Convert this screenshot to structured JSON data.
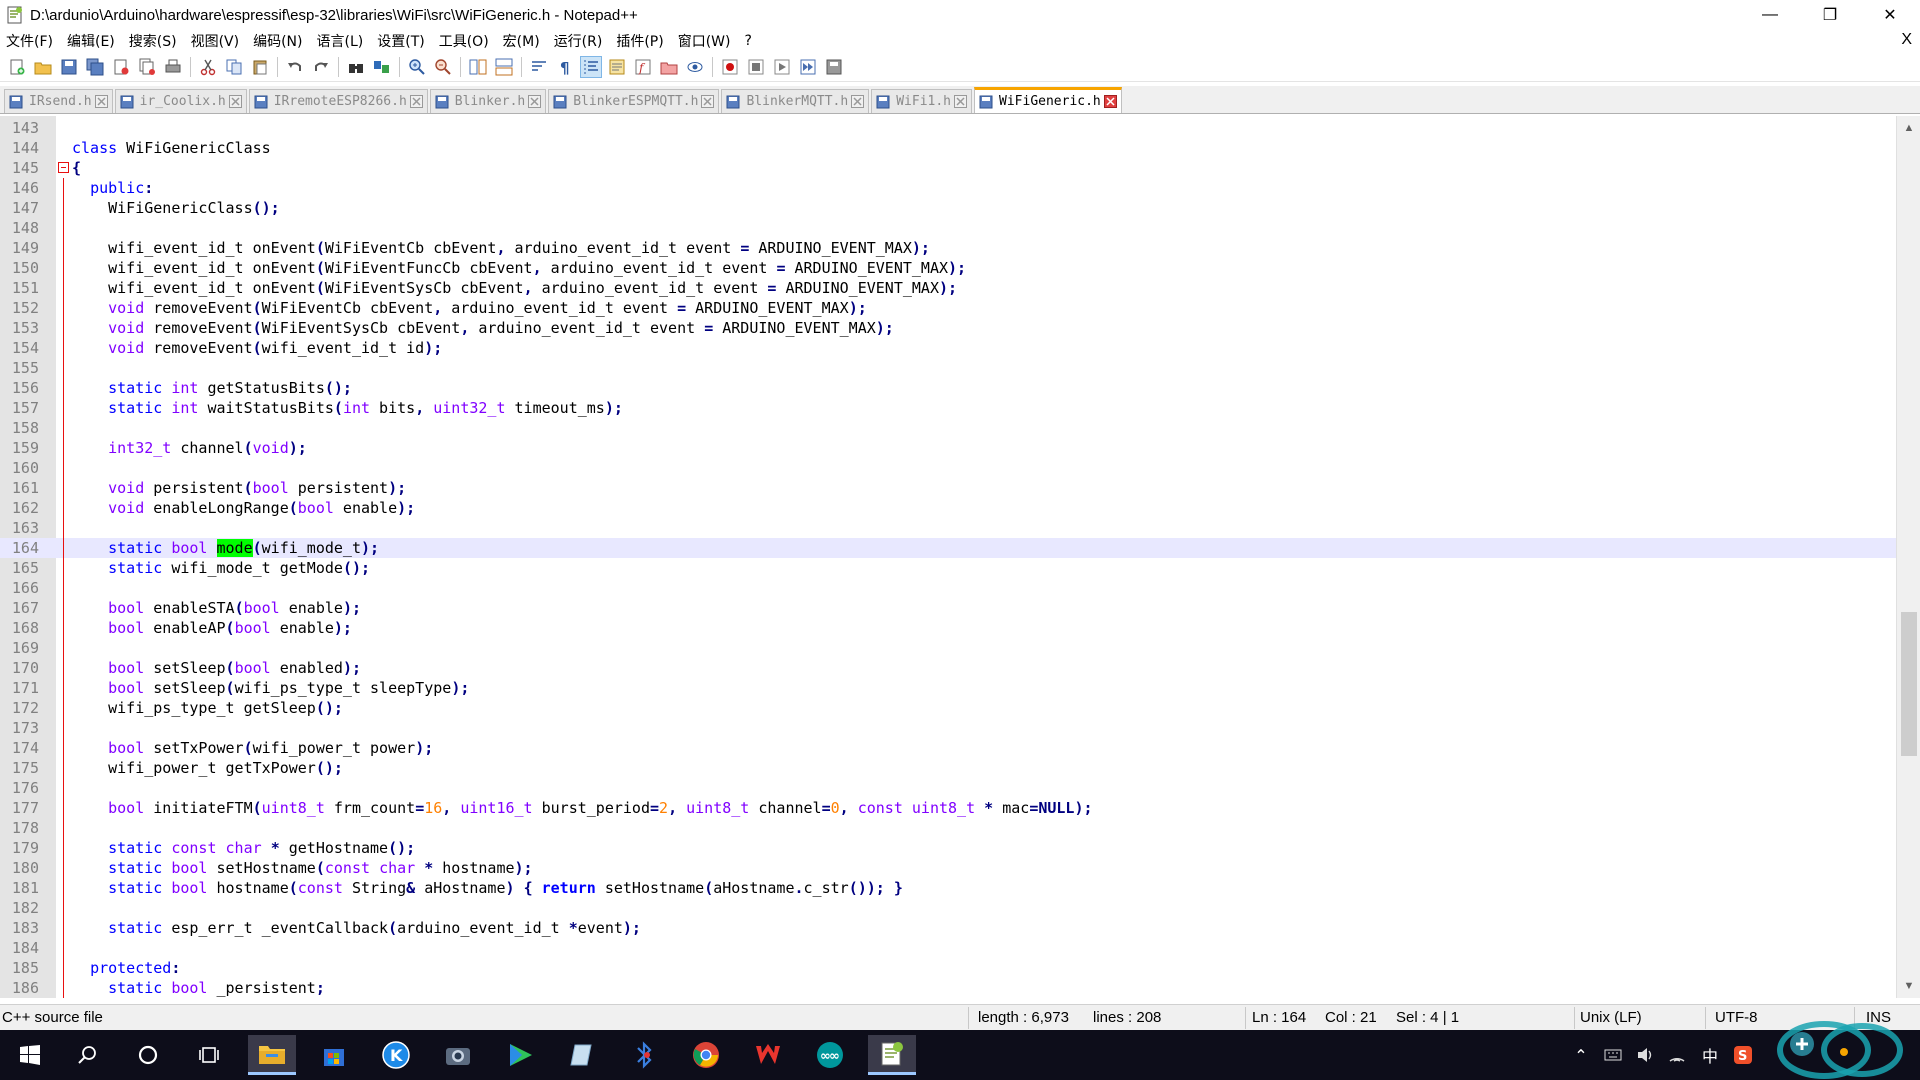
{
  "window": {
    "title": "D:\\ardunio\\Arduino\\hardware\\espressif\\esp-32\\libraries\\WiFi\\src\\WiFiGeneric.h - Notepad++",
    "minimize": "—",
    "maximize": "❐",
    "close": "✕"
  },
  "menu": {
    "items": [
      "文件(F)",
      "编辑(E)",
      "搜索(S)",
      "视图(V)",
      "编码(N)",
      "语言(L)",
      "设置(T)",
      "工具(O)",
      "宏(M)",
      "运行(R)",
      "插件(P)",
      "窗口(W)",
      "?"
    ],
    "close": "X"
  },
  "toolbar": {
    "icons": [
      "new-file-icon",
      "open-file-icon",
      "save-icon",
      "save-all-icon",
      "close-icon",
      "close-all-icon",
      "print-icon",
      "cut-icon",
      "copy-icon",
      "paste-icon",
      "undo-icon",
      "redo-icon",
      "find-icon",
      "replace-icon",
      "zoom-in-icon",
      "zoom-out-icon",
      "sync-vertical-icon",
      "sync-horizontal-icon",
      "word-wrap-icon",
      "show-all-chars-icon",
      "indent-guide-icon",
      "document-map-icon",
      "function-list-icon",
      "folder-as-workspace-icon",
      "monitoring-icon",
      "record-macro-icon",
      "stop-macro-icon",
      "play-macro-icon",
      "run-macro-multiple-icon",
      "save-macro-icon"
    ]
  },
  "tabs": [
    {
      "label": "IRsend.h",
      "active": false
    },
    {
      "label": "ir_Coolix.h",
      "active": false
    },
    {
      "label": "IRremoteESP8266.h",
      "active": false
    },
    {
      "label": "Blinker.h",
      "active": false
    },
    {
      "label": "BlinkerESPMQTT.h",
      "active": false
    },
    {
      "label": "BlinkerMQTT.h",
      "active": false
    },
    {
      "label": "WiFi1.h",
      "active": false
    },
    {
      "label": "WiFiGeneric.h",
      "active": true
    }
  ],
  "editor": {
    "current_line": 164,
    "lines": [
      {
        "n": "143",
        "html": ""
      },
      {
        "n": "144",
        "html": "<span class=\"kw\">class</span> WiFiGenericClass"
      },
      {
        "n": "145",
        "html": "<span class=\"op\">{</span>"
      },
      {
        "n": "146",
        "html": "  <span class=\"kw\">public</span><span class=\"op\">:</span>"
      },
      {
        "n": "147",
        "html": "    WiFiGenericClass<span class=\"op\">();</span>"
      },
      {
        "n": "148",
        "html": ""
      },
      {
        "n": "149",
        "html": "    wifi_event_id_t onEvent<span class=\"op\">(</span>WiFiEventCb cbEvent<span class=\"op\">,</span> arduino_event_id_t event <span class=\"op\">=</span> ARDUINO_EVENT_MAX<span class=\"op\">);</span>"
      },
      {
        "n": "150",
        "html": "    wifi_event_id_t onEvent<span class=\"op\">(</span>WiFiEventFuncCb cbEvent<span class=\"op\">,</span> arduino_event_id_t event <span class=\"op\">=</span> ARDUINO_EVENT_MAX<span class=\"op\">);</span>"
      },
      {
        "n": "151",
        "html": "    wifi_event_id_t onEvent<span class=\"op\">(</span>WiFiEventSysCb cbEvent<span class=\"op\">,</span> arduino_event_id_t event <span class=\"op\">=</span> ARDUINO_EVENT_MAX<span class=\"op\">);</span>"
      },
      {
        "n": "152",
        "html": "    <span class=\"ty\">void</span> removeEvent<span class=\"op\">(</span>WiFiEventCb cbEvent<span class=\"op\">,</span> arduino_event_id_t event <span class=\"op\">=</span> ARDUINO_EVENT_MAX<span class=\"op\">);</span>"
      },
      {
        "n": "153",
        "html": "    <span class=\"ty\">void</span> removeEvent<span class=\"op\">(</span>WiFiEventSysCb cbEvent<span class=\"op\">,</span> arduino_event_id_t event <span class=\"op\">=</span> ARDUINO_EVENT_MAX<span class=\"op\">);</span>"
      },
      {
        "n": "154",
        "html": "    <span class=\"ty\">void</span> removeEvent<span class=\"op\">(</span>wifi_event_id_t id<span class=\"op\">);</span>"
      },
      {
        "n": "155",
        "html": ""
      },
      {
        "n": "156",
        "html": "    <span class=\"kw\">static</span> <span class=\"ty\">int</span> getStatusBits<span class=\"op\">();</span>"
      },
      {
        "n": "157",
        "html": "    <span class=\"kw\">static</span> <span class=\"ty\">int</span> waitStatusBits<span class=\"op\">(</span><span class=\"ty\">int</span> bits<span class=\"op\">,</span> <span class=\"ty\">uint32_t</span> timeout_ms<span class=\"op\">);</span>"
      },
      {
        "n": "158",
        "html": ""
      },
      {
        "n": "159",
        "html": "    <span class=\"ty\">int32_t</span> channel<span class=\"op\">(</span><span class=\"ty\">void</span><span class=\"op\">);</span>"
      },
      {
        "n": "160",
        "html": ""
      },
      {
        "n": "161",
        "html": "    <span class=\"ty\">void</span> persistent<span class=\"op\">(</span><span class=\"ty\">bool</span> persistent<span class=\"op\">);</span>"
      },
      {
        "n": "162",
        "html": "    <span class=\"ty\">void</span> enableLongRange<span class=\"op\">(</span><span class=\"ty\">bool</span> enable<span class=\"op\">);</span>"
      },
      {
        "n": "163",
        "html": ""
      },
      {
        "n": "164",
        "html": "    <span class=\"kw\">static</span> <span class=\"ty\">bool</span> <span class=\"hl\">mode</span><span class=\"op\">(</span>wifi_mode_t<span class=\"op\">);</span>"
      },
      {
        "n": "165",
        "html": "    <span class=\"kw\">static</span> wifi_mode_t getMode<span class=\"op\">();</span>"
      },
      {
        "n": "166",
        "html": ""
      },
      {
        "n": "167",
        "html": "    <span class=\"ty\">bool</span> enableSTA<span class=\"op\">(</span><span class=\"ty\">bool</span> enable<span class=\"op\">);</span>"
      },
      {
        "n": "168",
        "html": "    <span class=\"ty\">bool</span> enableAP<span class=\"op\">(</span><span class=\"ty\">bool</span> enable<span class=\"op\">);</span>"
      },
      {
        "n": "169",
        "html": ""
      },
      {
        "n": "170",
        "html": "    <span class=\"ty\">bool</span> setSleep<span class=\"op\">(</span><span class=\"ty\">bool</span> enabled<span class=\"op\">);</span>"
      },
      {
        "n": "171",
        "html": "    <span class=\"ty\">bool</span> setSleep<span class=\"op\">(</span>wifi_ps_type_t sleepType<span class=\"op\">);</span>"
      },
      {
        "n": "172",
        "html": "    wifi_ps_type_t getSleep<span class=\"op\">();</span>"
      },
      {
        "n": "173",
        "html": ""
      },
      {
        "n": "174",
        "html": "    <span class=\"ty\">bool</span> setTxPower<span class=\"op\">(</span>wifi_power_t power<span class=\"op\">);</span>"
      },
      {
        "n": "175",
        "html": "    wifi_power_t getTxPower<span class=\"op\">();</span>"
      },
      {
        "n": "176",
        "html": ""
      },
      {
        "n": "177",
        "html": "    <span class=\"ty\">bool</span> initiateFTM<span class=\"op\">(</span><span class=\"ty\">uint8_t</span> frm_count<span class=\"op\">=</span><span class=\"num\">16</span><span class=\"op\">,</span> <span class=\"ty\">uint16_t</span> burst_period<span class=\"op\">=</span><span class=\"num\">2</span><span class=\"op\">,</span> <span class=\"ty\">uint8_t</span> channel<span class=\"op\">=</span><span class=\"num\">0</span><span class=\"op\">,</span> <span class=\"ty\">const</span> <span class=\"ty\">uint8_t</span> <span class=\"op\">*</span> mac<span class=\"op\">=</span><span class=\"op\">NULL);</span>"
      },
      {
        "n": "178",
        "html": ""
      },
      {
        "n": "179",
        "html": "    <span class=\"kw\">static</span> <span class=\"ty\">const</span> <span class=\"ty\">char</span> <span class=\"op\">*</span> getHostname<span class=\"op\">();</span>"
      },
      {
        "n": "180",
        "html": "    <span class=\"kw\">static</span> <span class=\"ty\">bool</span> setHostname<span class=\"op\">(</span><span class=\"ty\">const</span> <span class=\"ty\">char</span> <span class=\"op\">*</span> hostname<span class=\"op\">);</span>"
      },
      {
        "n": "181",
        "html": "    <span class=\"kw\">static</span> <span class=\"ty\">bool</span> hostname<span class=\"op\">(</span><span class=\"ty\">const</span> String<span class=\"op\">&amp;</span> aHostname<span class=\"op\">)</span> <span class=\"op\">{</span> <span class=\"op\" style=\"color:#0000ff\">return</span> setHostname<span class=\"op\">(</span>aHostname<span class=\"op\">.</span>c_str<span class=\"op\">());</span> <span class=\"op\">}</span>"
      },
      {
        "n": "182",
        "html": ""
      },
      {
        "n": "183",
        "html": "    <span class=\"kw\">static</span> esp_err_t _eventCallback<span class=\"op\">(</span>arduino_event_id_t <span class=\"op\">*</span>event<span class=\"op\">);</span>"
      },
      {
        "n": "184",
        "html": ""
      },
      {
        "n": "185",
        "html": "  <span class=\"kw\">protected</span><span class=\"op\">:</span>"
      },
      {
        "n": "186",
        "html": "    <span class=\"kw\">static</span> <span class=\"ty\">bool</span> _persistent<span class=\"op\">;</span>"
      }
    ]
  },
  "status": {
    "file_type": "C++ source file",
    "length": "length : 6,973",
    "lines": "lines : 208",
    "ln": "Ln : 164",
    "col": "Col : 21",
    "sel": "Sel : 4 | 1",
    "eol": "Unix (LF)",
    "encoding": "UTF-8",
    "mode": "INS"
  },
  "taskbar": {
    "apps": [
      "windows-start-icon",
      "search-icon",
      "cortana-icon",
      "task-view-icon",
      "file-explorer-icon",
      "microsoft-store-icon",
      "kugou-music-icon",
      "camera-icon",
      "video-player-icon",
      "notes-icon",
      "bluetooth-tool-icon",
      "chrome-icon",
      "wps-office-icon",
      "arduino-icon",
      "notepadpp-icon"
    ],
    "tray_ime": "中"
  },
  "colors": {
    "keyword": "#0000ff",
    "type": "#8000ff",
    "operator": "#000080",
    "number": "#ff8000",
    "match_highlight": "#00ff00",
    "current_line": "#e8e8ff",
    "active_tab_accent": "#f7a400"
  }
}
